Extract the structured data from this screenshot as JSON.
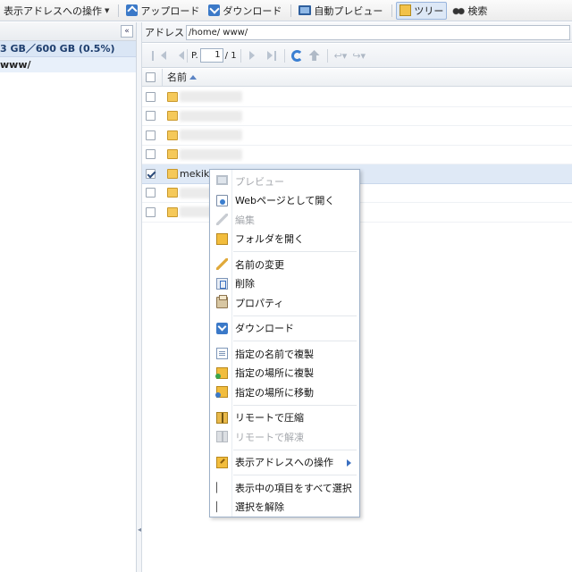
{
  "toolbar": {
    "address_ops": "表示アドレスへの操作",
    "upload": "アップロード",
    "download": "ダウンロード",
    "auto_preview": "自動プレビュー",
    "tree": "ツリー",
    "search": "検索"
  },
  "left_panel": {
    "collapse_glyph": "«",
    "drive_usage": "3 GB／600 GB (0.5%)",
    "tree_item": "www/"
  },
  "address_bar": {
    "label": "アドレス",
    "path": "/home/             www/"
  },
  "pager": {
    "page_label": "P.",
    "page_value": "1",
    "page_total": "/ 1"
  },
  "grid": {
    "name_header": "名前",
    "selected_file": "mekiki"
  },
  "context_menu": {
    "preview": "プレビュー",
    "open_web": "Webページとして開く",
    "edit": "編集",
    "open_folder": "フォルダを開く",
    "rename": "名前の変更",
    "delete": "削除",
    "properties": "プロパティ",
    "download": "ダウンロード",
    "copy_name": "指定の名前で複製",
    "copy_to": "指定の場所に複製",
    "move_to": "指定の場所に移動",
    "compress": "リモートで圧縮",
    "extract": "リモートで解凍",
    "address_ops": "表示アドレスへの操作",
    "select_all": "表示中の項目をすべて選択",
    "deselect": "選択を解除"
  },
  "colors": {
    "accent": "#3b79c8",
    "selection": "#dfe9f6",
    "folder": "#f5c95a"
  }
}
